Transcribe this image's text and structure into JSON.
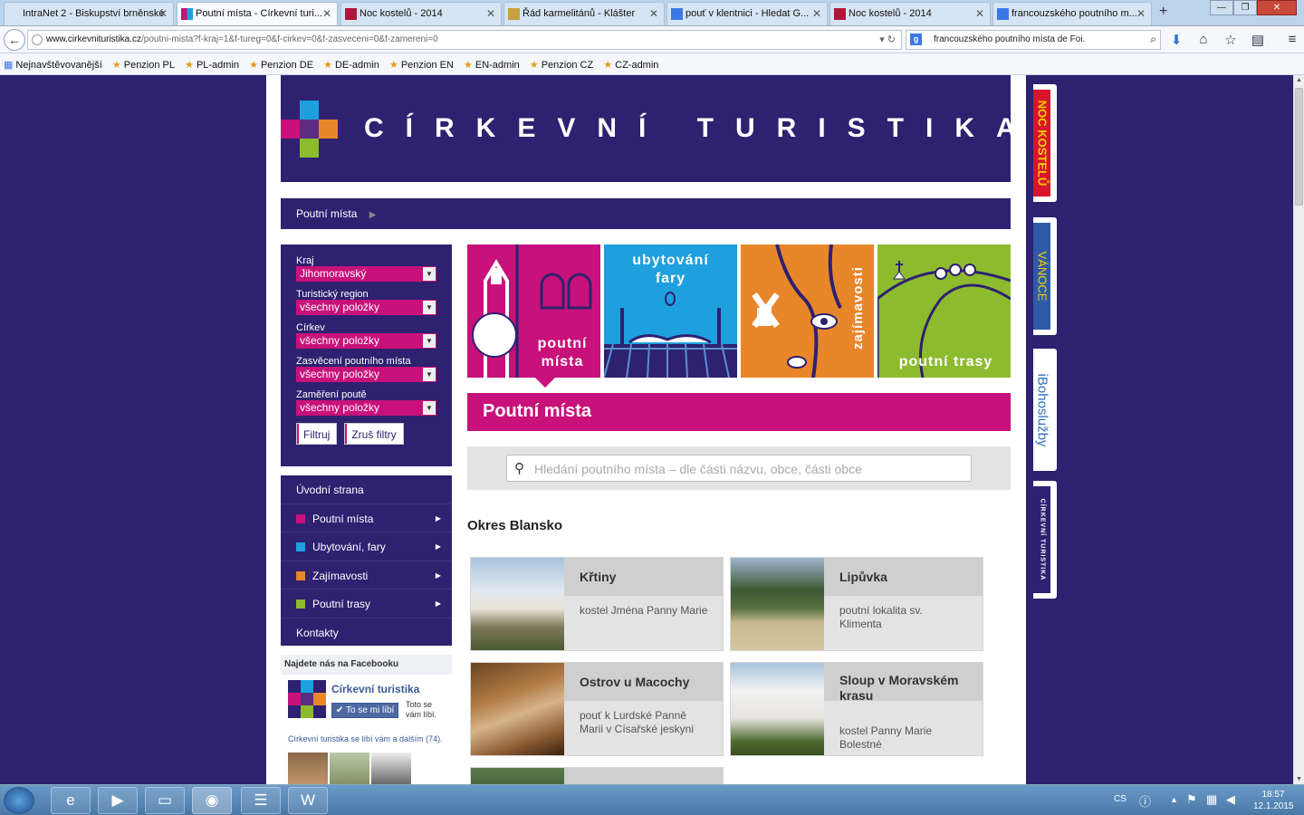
{
  "browser": {
    "tabs": [
      {
        "label": "IntraNet 2 - Biskupství brněnské",
        "favicon": "intranet-icon",
        "active": false
      },
      {
        "label": "Poutní místa - Církevní turi...",
        "favicon": "cirkevni-turistika-icon",
        "active": true
      },
      {
        "label": "Noc kostelů - 2014",
        "favicon": "noc-kostelu-icon",
        "active": false
      },
      {
        "label": "Řád karmelitánů - Klášter",
        "favicon": "karmel-icon",
        "active": false
      },
      {
        "label": "pouť v klentnici - Hledat G...",
        "favicon": "google-icon",
        "active": false
      },
      {
        "label": "Noc kostelů - 2014",
        "favicon": "noc-kostelu-icon",
        "active": false
      },
      {
        "label": "francouzského poutního m...",
        "favicon": "google-icon",
        "active": false
      }
    ],
    "url_domain": "www.cirkevnituristika.cz",
    "url_path": "/poutni-mista?f-kraj=1&f-tureg=0&f-cirkev=0&f-zasveceni=0&f-zamereni=0",
    "search_value": "francouzského poutního místa de Foi.",
    "bookmarks": [
      {
        "label": "Nejnavštěvovanější"
      },
      {
        "label": "Penzion PL"
      },
      {
        "label": "PL-admin"
      },
      {
        "label": "Penzion DE"
      },
      {
        "label": "DE-admin"
      },
      {
        "label": "Penzion EN"
      },
      {
        "label": "EN-admin"
      },
      {
        "label": "Penzion CZ"
      },
      {
        "label": "CZ-admin"
      }
    ]
  },
  "site": {
    "title": "CÍRKEVNÍ TURISTIKA",
    "breadcrumb": "Poutní místa",
    "filters": [
      {
        "label": "Kraj",
        "value": "Jihomoravský"
      },
      {
        "label": "Turistický region",
        "value": "všechny položky"
      },
      {
        "label": "Církev",
        "value": "všechny položky"
      },
      {
        "label": "Zasvěcení poutního místa",
        "value": "všechny položky"
      },
      {
        "label": "Zaměření poutě",
        "value": "všechny položky"
      }
    ],
    "filter_button": "Filtruj",
    "reset_button": "Zruš filtry",
    "menu": [
      {
        "label": "Úvodní strana",
        "color": "",
        "arrow": false
      },
      {
        "label": "Poutní místa",
        "color": "#c8117a",
        "arrow": true
      },
      {
        "label": "Ubytování, fary",
        "color": "#1ea0de",
        "arrow": true
      },
      {
        "label": "Zajímavosti",
        "color": "#e8862a",
        "arrow": true
      },
      {
        "label": "Poutní trasy",
        "color": "#8dbb2e",
        "arrow": true
      },
      {
        "label": "Kontakty",
        "color": "",
        "arrow": false
      }
    ],
    "facebook": {
      "heading": "Najdete nás na Facebooku",
      "page_name": "Církevní turistika",
      "like_button": "To se mi líbí",
      "toto_line1": "Toto se",
      "toto_line2": "vám líbí.",
      "fans_link": "Církevní turistika",
      "fans_text": " se líbí vám a dalším (74)."
    },
    "tiles": [
      {
        "line1": "poutní",
        "line2": "místa",
        "color": "#c8117a"
      },
      {
        "line1": "ubytování",
        "line2": "fary",
        "color": "#1ea0de"
      },
      {
        "line1": "zajímavosti",
        "line2": "",
        "color": "#e8862a"
      },
      {
        "line1": "poutní trasy",
        "line2": "",
        "color": "#8dbb2e"
      }
    ],
    "page_title": "Poutní místa",
    "search_placeholder": "Hledání poutního místa – dle části názvu, obce, části obce",
    "district": "Okres Blansko",
    "places": [
      {
        "name": "Křtiny",
        "desc1": "kostel Jména Panny Marie",
        "desc2": ""
      },
      {
        "name": "Lipůvka",
        "desc1": "poutní lokalita sv.",
        "desc2": "Klimenta"
      },
      {
        "name": "Ostrov u Macochy",
        "desc1": "pouť k Lurdské Panně",
        "desc2": "Marii v Císařské jeskyni"
      },
      {
        "name1": "Sloup v Moravském",
        "name2": "krasu",
        "desc1": "kostel Panny Marie",
        "desc2": "Bolestné"
      }
    ],
    "side_tabs": [
      "NOC KOSTELŮ",
      "VÁNOCE",
      "iBohoslužby",
      "CÍRKEVNÍ TURISTIKA"
    ]
  },
  "taskbar": {
    "lang": "CS",
    "time": "18:57",
    "date": "12.1.2015"
  }
}
